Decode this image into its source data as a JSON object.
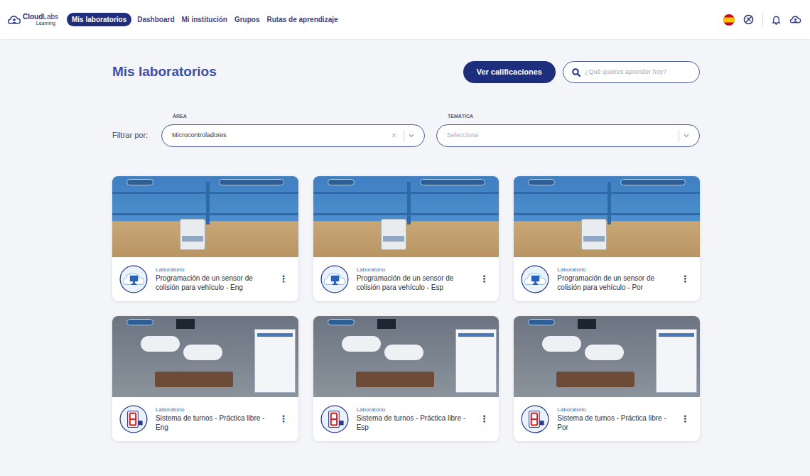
{
  "logo": {
    "brand_bold": "Cloud",
    "brand_light": "Labs",
    "sub": "Learning"
  },
  "nav": {
    "items": [
      {
        "label": "Mis laboratorios",
        "selected": true
      },
      {
        "label": "Dashboard",
        "selected": false
      },
      {
        "label": "Mi institución",
        "selected": false
      },
      {
        "label": "Grupos",
        "selected": false
      },
      {
        "label": "Rutas de aprendizaje",
        "selected": false
      }
    ]
  },
  "page": {
    "title": "Mis laboratorios"
  },
  "grades_button": "Ver calificaciones",
  "search": {
    "placeholder": "¿Qué quieres aprender hoy?"
  },
  "filters": {
    "label": "Filtrar por:",
    "area": {
      "label": "ÁREA",
      "value": "Microcontroladores",
      "clear": "×"
    },
    "tematica": {
      "label": "TEMÁTICA",
      "placeholder": "Selecciona"
    }
  },
  "cards": [
    {
      "kind": "sensor",
      "type": "Laboratorio",
      "title": "Programación de un sensor de colisión para vehículo - Eng",
      "menu": "⋮"
    },
    {
      "kind": "sensor",
      "type": "Laboratorio",
      "title": "Programación de un sensor de colisión para vehículo - Esp",
      "menu": "⋮"
    },
    {
      "kind": "sensor",
      "type": "Laboratorio",
      "title": "Programación de un sensor de colisión para vehículo - Por",
      "menu": "⋮"
    },
    {
      "kind": "display",
      "type": "Laboratorio",
      "title": "Sistema de turnos - Práctica libre - Eng",
      "menu": "⋮"
    },
    {
      "kind": "display",
      "type": "Laboratorio",
      "title": "Sistema de turnos - Práctica libre - Esp",
      "menu": "⋮"
    },
    {
      "kind": "display",
      "type": "Laboratorio",
      "title": "Sistema de turnos - Práctica libre - Por",
      "menu": "⋮"
    }
  ]
}
